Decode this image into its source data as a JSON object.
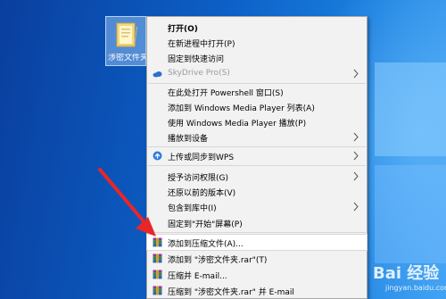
{
  "desktop": {
    "folder": {
      "label": "涉密文件夹",
      "icon": "folder-icon"
    }
  },
  "context_menu": {
    "items": [
      {
        "label": "打开(O)",
        "bold": true
      },
      {
        "label": "在新进程中打开(P)"
      },
      {
        "label": "固定到快速访问"
      },
      {
        "label": "SkyDrive Pro(S)",
        "disabled": true,
        "icon": "cloud-icon",
        "submenu": true
      },
      {
        "label": "在此处打开 Powershell 窗口(S)"
      },
      {
        "label": "添加到 Windows Media Player 列表(A)"
      },
      {
        "label": "使用 Windows Media Player 播放(P)"
      },
      {
        "label": "播放到设备",
        "submenu": true
      },
      {
        "label": "上传或同步到WPS",
        "icon": "wps-cloud-icon",
        "submenu": true
      },
      {
        "label": "授予访问权限(G)",
        "submenu": true
      },
      {
        "label": "还原以前的版本(V)"
      },
      {
        "label": "包含到库中(I)",
        "submenu": true
      },
      {
        "label": "固定到\"开始\"屏幕(P)"
      },
      {
        "label": "添加到压缩文件(A)...",
        "icon": "winrar-icon",
        "highlight": true
      },
      {
        "label": "添加到 \"涉密文件夹.rar\"(T)",
        "icon": "winrar-icon"
      },
      {
        "label": "压缩并 E-mail...",
        "icon": "winrar-icon"
      },
      {
        "label": "压缩到 \"涉密文件夹.rar\" 并 E-mail",
        "icon": "winrar-icon"
      }
    ]
  },
  "watermark": {
    "main": "Bai 经验",
    "sub": "jingyan.baidu.com"
  },
  "colors": {
    "annotation": "#e8262a",
    "menu_bg": "#f2f2f2"
  }
}
